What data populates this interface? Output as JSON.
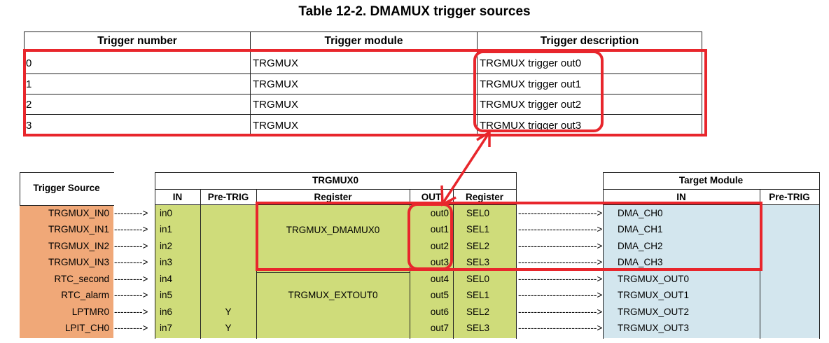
{
  "caption": "Table 12-2.  DMAMUX trigger sources",
  "trigger_table": {
    "headers": [
      "Trigger number",
      "Trigger module",
      "Trigger description"
    ],
    "rows": [
      {
        "number": "0",
        "module": "TRGMUX",
        "description": "TRGMUX trigger out0"
      },
      {
        "number": "1",
        "module": "TRGMUX",
        "description": "TRGMUX trigger out1"
      },
      {
        "number": "2",
        "module": "TRGMUX",
        "description": "TRGMUX trigger out2"
      },
      {
        "number": "3",
        "module": "TRGMUX",
        "description": "TRGMUX trigger out3"
      }
    ]
  },
  "diagram": {
    "trigger_source_header": "Trigger Source",
    "trgmux_header": "TRGMUX0",
    "trgmux_cols": [
      "IN",
      "Pre-TRIG",
      "Register",
      "OUT",
      "Register"
    ],
    "target_header": "Target Module",
    "target_cols": [
      "IN",
      "Pre-TRIG"
    ],
    "sources": [
      "TRGMUX_IN0",
      "TRGMUX_IN1",
      "TRGMUX_IN2",
      "TRGMUX_IN3",
      "RTC_second",
      "RTC_alarm",
      "LPTMR0",
      "LPIT_CH0"
    ],
    "ins": [
      "in0",
      "in1",
      "in2",
      "in3",
      "in4",
      "in5",
      "in6",
      "in7"
    ],
    "pretrig": [
      "",
      "",
      "",
      "",
      "",
      "",
      "Y",
      "Y"
    ],
    "registers": [
      "TRGMUX_DMAMUX0",
      "TRGMUX_EXTOUT0"
    ],
    "outs": [
      "out0",
      "out1",
      "out2",
      "out3",
      "out4",
      "out5",
      "out6",
      "out7"
    ],
    "sels": [
      "SEL0",
      "SEL1",
      "SEL2",
      "SEL3",
      "SEL0",
      "SEL1",
      "SEL2",
      "SEL3"
    ],
    "targets": [
      "DMA_CH0",
      "DMA_CH1",
      "DMA_CH2",
      "DMA_CH3",
      "TRGMUX_OUT0",
      "TRGMUX_OUT1",
      "TRGMUX_OUT2",
      "TRGMUX_OUT3"
    ],
    "short_arrow": "--------->",
    "long_arrow": "------------------------->",
    "colors": {
      "source": "#f0a878",
      "trgmux": "#cfdc7a",
      "target": "#d3e6ee",
      "highlight": "#e8262c"
    }
  }
}
